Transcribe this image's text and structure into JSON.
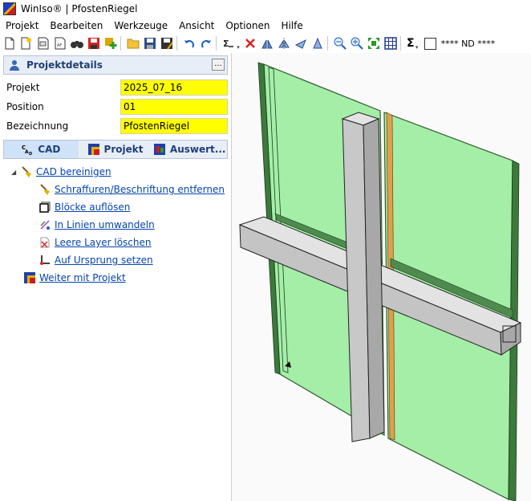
{
  "window": {
    "title": "WinIso® | PfostenRiegel"
  },
  "menu": [
    "Projekt",
    "Bearbeiten",
    "Werkzeuge",
    "Ansicht",
    "Optionen",
    "Hilfe"
  ],
  "toolbar": {
    "icons": [
      "new-icon",
      "open-template-icon",
      "new-sheet-icon",
      "new-doc-icon",
      "binoculars-icon",
      "save-red-icon",
      "add-icon",
      "folder-open-icon",
      "save-icon",
      "save-as-icon",
      "undo-icon",
      "redo-icon",
      "settings-icon",
      "delete-icon",
      "mirror-icon",
      "flip-icon",
      "rotate-icon",
      "align-icon",
      "zoom-out-icon",
      "zoom-in-icon",
      "zoom-extents-icon",
      "grid-icon"
    ],
    "sigma": "Σ",
    "layer_label": "**** ND ****"
  },
  "panel": {
    "title": "Projektdetails",
    "ellipsis": "...",
    "fields": [
      {
        "label": "Projekt",
        "value": "2025_07_16"
      },
      {
        "label": "Position",
        "value": "01"
      },
      {
        "label": "Bezeichnung",
        "value": "PfostenRiegel"
      }
    ]
  },
  "tabs": [
    {
      "label": "CAD",
      "icon": "cad-icon",
      "active": true
    },
    {
      "label": "Projekt",
      "icon": "project-icon",
      "active": false
    },
    {
      "label": "Auswert...",
      "icon": "evaluation-icon",
      "active": false
    }
  ],
  "tree": {
    "root": {
      "label": "CAD bereinigen",
      "icon": "broom-icon",
      "expanded": true
    },
    "children": [
      {
        "label": "Schraffuren/Beschriftung entfernen",
        "icon": "brush-icon"
      },
      {
        "label": "Blöcke auflösen",
        "icon": "block-icon"
      },
      {
        "label": "In Linien umwandeln",
        "icon": "lines-icon"
      },
      {
        "label": "Leere Layer löschen",
        "icon": "layer-delete-icon"
      },
      {
        "label": "Auf Ursprung setzen",
        "icon": "origin-icon"
      }
    ],
    "next": {
      "label": "Weiter mit Projekt",
      "icon": "project-icon"
    }
  },
  "colors": {
    "accent": "#1f3f77",
    "field_bg": "#ffff00",
    "link": "#0645ad",
    "glass": "#a4eea8",
    "frame": "#d0d0d0"
  }
}
